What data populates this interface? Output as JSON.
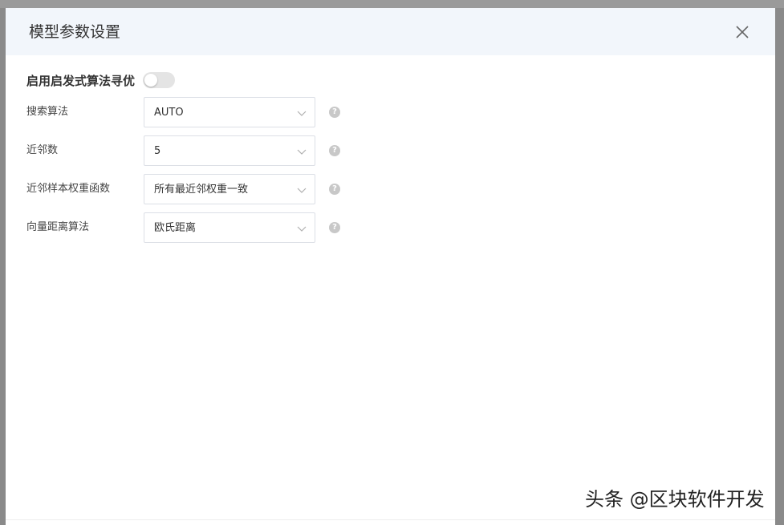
{
  "dialog": {
    "title": "模型参数设置",
    "close_icon": "close-icon"
  },
  "heuristic": {
    "label": "启用启发式算法寻优",
    "enabled": false
  },
  "fields": [
    {
      "label": "搜索算法",
      "value": "AUTO"
    },
    {
      "label": "近邻数",
      "value": "5"
    },
    {
      "label": "近邻样本权重函数",
      "value": "所有最近邻权重一致"
    },
    {
      "label": "向量距离算法",
      "value": "欧氏距离"
    }
  ],
  "help_icon_text": "?",
  "watermark": "头条 @区块软件开发",
  "colors": {
    "header_bg": "#f2f6fb",
    "toggle_off": "#e4e4e4",
    "border": "#dcdfe6",
    "help_icon": "#c8c8c8"
  }
}
